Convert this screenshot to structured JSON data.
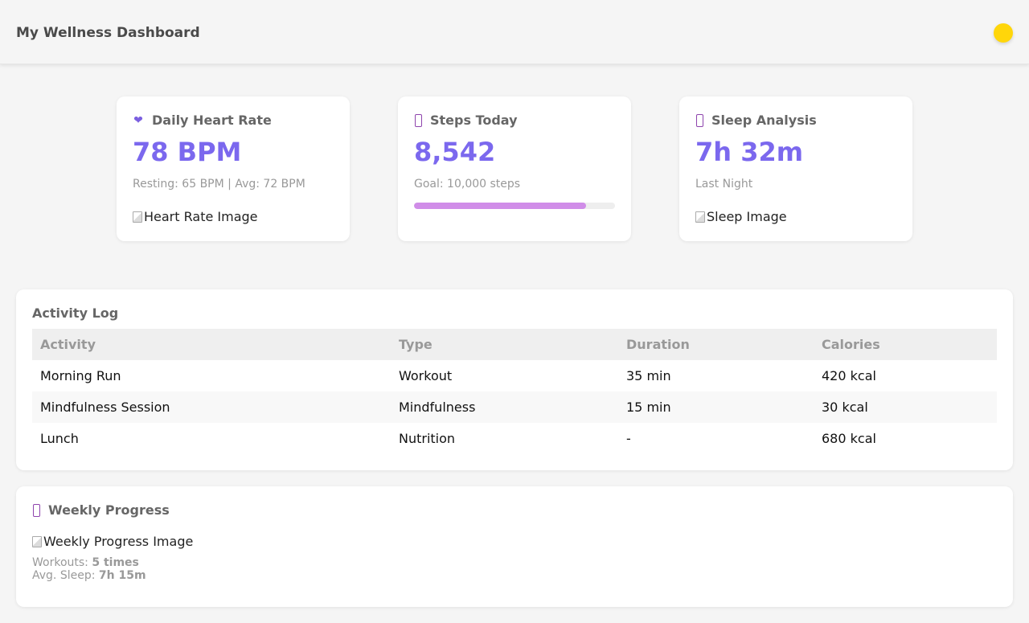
{
  "header": {
    "title": "My Wellness Dashboard",
    "status_color": "#ffd60a"
  },
  "cards": [
    {
      "icon": "heart-icon",
      "title": "Daily Heart Rate",
      "value": "78 BPM",
      "sub": "Resting: 65 BPM | Avg: 72 BPM",
      "image_alt": "Heart Rate Image"
    },
    {
      "icon": "footsteps-icon",
      "title": "Steps Today",
      "value": "8,542",
      "sub": "Goal: 10,000 steps",
      "progress_percent": 85.42
    },
    {
      "icon": "moon-icon",
      "title": "Sleep Analysis",
      "value": "7h 32m",
      "sub": "Last Night",
      "image_alt": "Sleep Image"
    }
  ],
  "activity_log": {
    "title": "Activity Log",
    "columns": [
      "Activity",
      "Type",
      "Duration",
      "Calories"
    ],
    "rows": [
      [
        "Morning Run",
        "Workout",
        "35 min",
        "420 kcal"
      ],
      [
        "Mindfulness Session",
        "Mindfulness",
        "15 min",
        "30 kcal"
      ],
      [
        "Lunch",
        "Nutrition",
        "-",
        "680 kcal"
      ]
    ]
  },
  "weekly_progress": {
    "icon": "chart-icon",
    "title": "Weekly Progress",
    "image_alt": "Weekly Progress Image",
    "workouts_label": "Workouts:",
    "workouts_value": "5 times",
    "sleep_label": "Avg. Sleep:",
    "sleep_value": "7h 15m"
  },
  "colors": {
    "accent": "#7b68ee",
    "progress": "#d08de8"
  }
}
